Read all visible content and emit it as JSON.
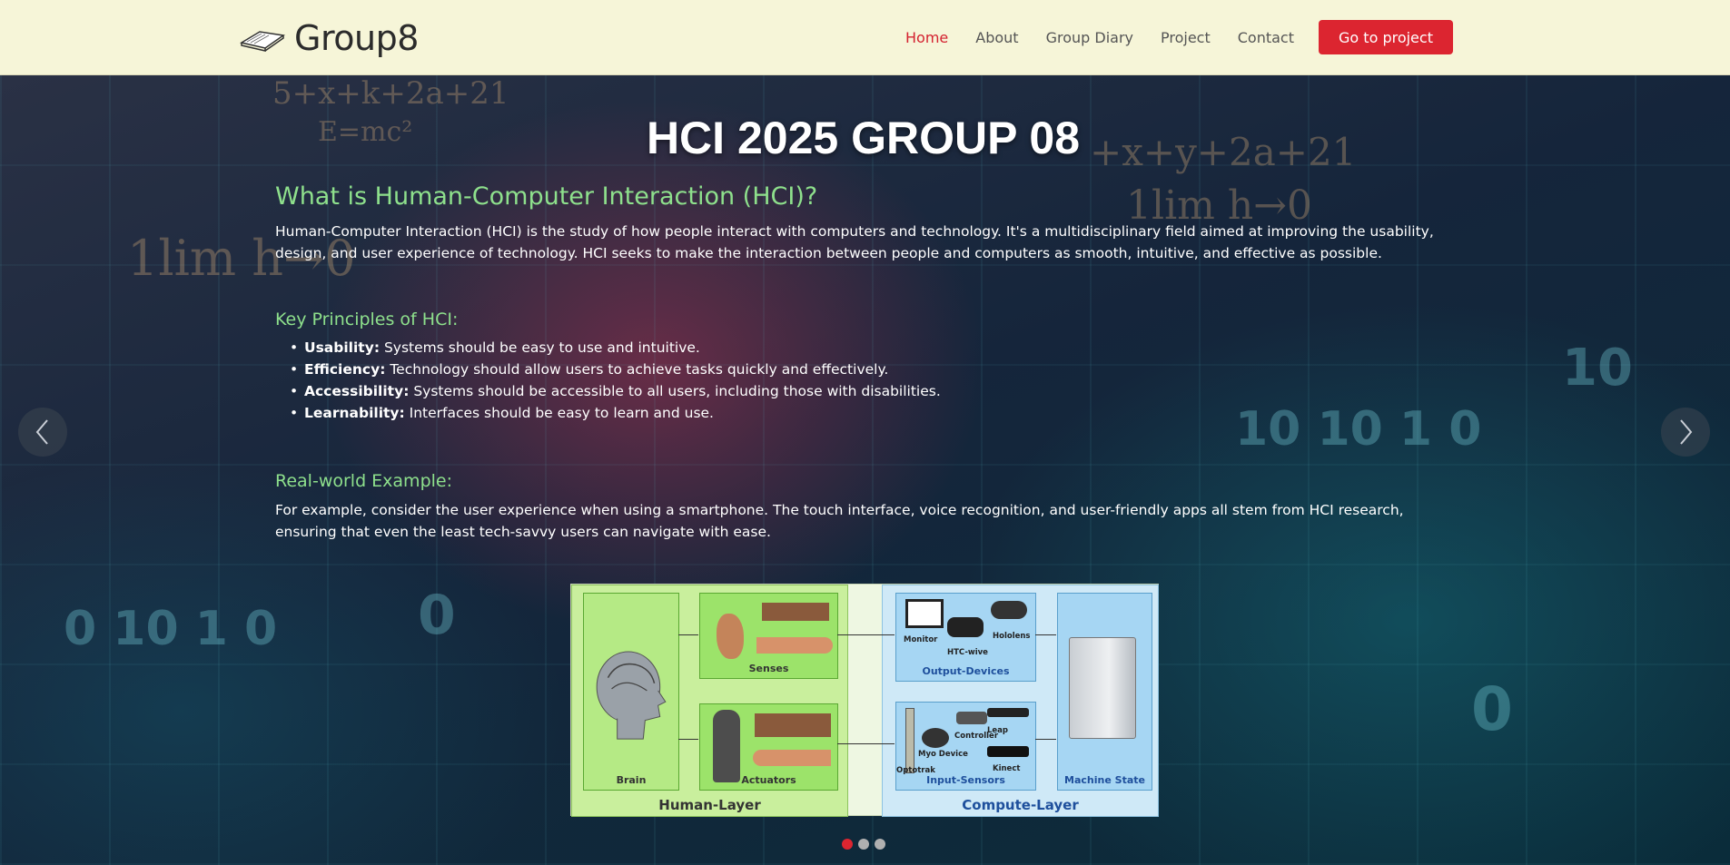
{
  "header": {
    "brand": "Group8",
    "nav": [
      {
        "label": "Home",
        "active": true
      },
      {
        "label": "About",
        "active": false
      },
      {
        "label": "Group Diary",
        "active": false
      },
      {
        "label": "Project",
        "active": false
      },
      {
        "label": "Contact",
        "active": false
      }
    ],
    "cta_label": "Go to project"
  },
  "hero": {
    "title": "HCI 2025 GROUP 08",
    "section1": {
      "heading": "What is Human-Computer Interaction (HCI)?",
      "text": "Human-Computer Interaction (HCI) is the study of how people interact with computers and technology. It's a multidisciplinary field aimed at improving the usability, design, and user experience of technology. HCI seeks to make the interaction between people and computers as smooth, intuitive, and effective as possible."
    },
    "section2": {
      "heading": "Key Principles of HCI:",
      "items": [
        {
          "term": "Usability:",
          "text": " Systems should be easy to use and intuitive."
        },
        {
          "term": "Efficiency:",
          "text": " Technology should allow users to achieve tasks quickly and effectively."
        },
        {
          "term": "Accessibility:",
          "text": " Systems should be accessible to all users, including those with disabilities."
        },
        {
          "term": "Learnability:",
          "text": " Interfaces should be easy to learn and use."
        }
      ]
    },
    "section3": {
      "heading": "Real-world Example:",
      "text": "For example, consider the user experience when using a smartphone. The touch interface, voice recognition, and user-friendly apps all stem from HCI research, ensuring that even the least tech-savvy users can navigate with ease."
    }
  },
  "diagram": {
    "human_layer": "Human-Layer",
    "compute_layer": "Compute-Layer",
    "brain": "Brain",
    "senses": "Senses",
    "actuators": "Actuators",
    "output_devices": "Output-Devices",
    "input_sensors": "Input-Sensors",
    "machine_state": "Machine State",
    "labels": {
      "monitor": "Monitor",
      "htc": "HTC-wive",
      "hololens": "Hololens",
      "controller": "Controller",
      "leap": "Leap",
      "myo": "Myo Device",
      "optotrak": "Optotrak",
      "kinect": "Kinect"
    }
  },
  "carousel": {
    "slides": 3,
    "active": 1
  },
  "colors": {
    "accent": "#dc2530",
    "heading_green": "#8ee08c",
    "header_bg": "#f6f5d8"
  }
}
